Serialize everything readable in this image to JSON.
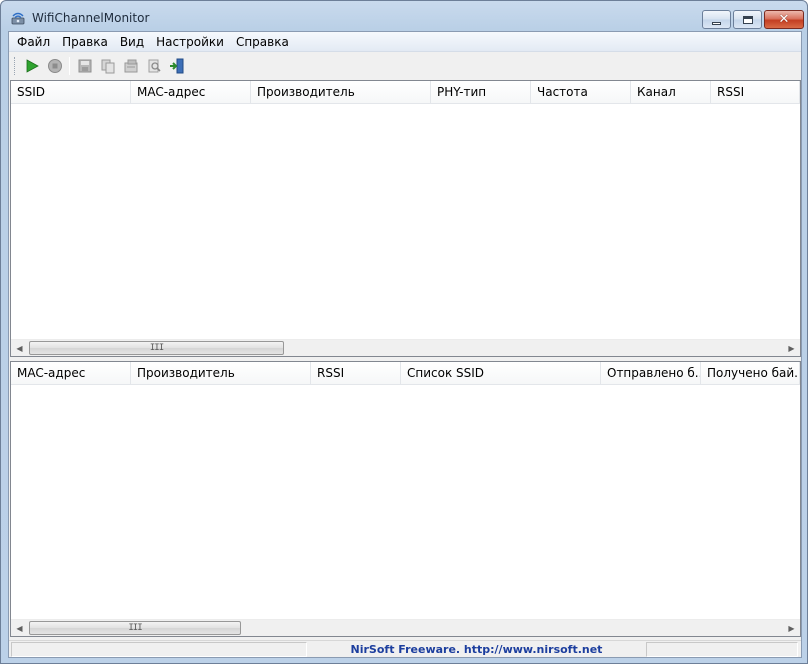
{
  "window": {
    "title": "WifiChannelMonitor"
  },
  "menu": [
    "Файл",
    "Правка",
    "Вид",
    "Настройки",
    "Справка"
  ],
  "toolbar": {
    "icons": [
      "play-icon",
      "stop-icon",
      "save-icon",
      "copy-icon",
      "properties-icon",
      "find-icon",
      "exit-icon"
    ]
  },
  "top_list": {
    "columns": [
      "SSID",
      "MAC-адрес",
      "Производитель",
      "PHY-тип",
      "Частота",
      "Канал",
      "RSSI"
    ],
    "rows": []
  },
  "bottom_list": {
    "columns": [
      "MAC-адрес",
      "Производитель",
      "RSSI",
      "Список SSID",
      "Отправлено б...",
      "Получено бай..."
    ],
    "rows": []
  },
  "scrollbar_grip": "III",
  "status": {
    "link_text": "NirSoft Freeware.  http://www.nirsoft.net"
  },
  "colors": {
    "accent_link": "#1c3e9e",
    "play_green": "#2fa32f",
    "stop_gray": "#9a9a9a"
  }
}
